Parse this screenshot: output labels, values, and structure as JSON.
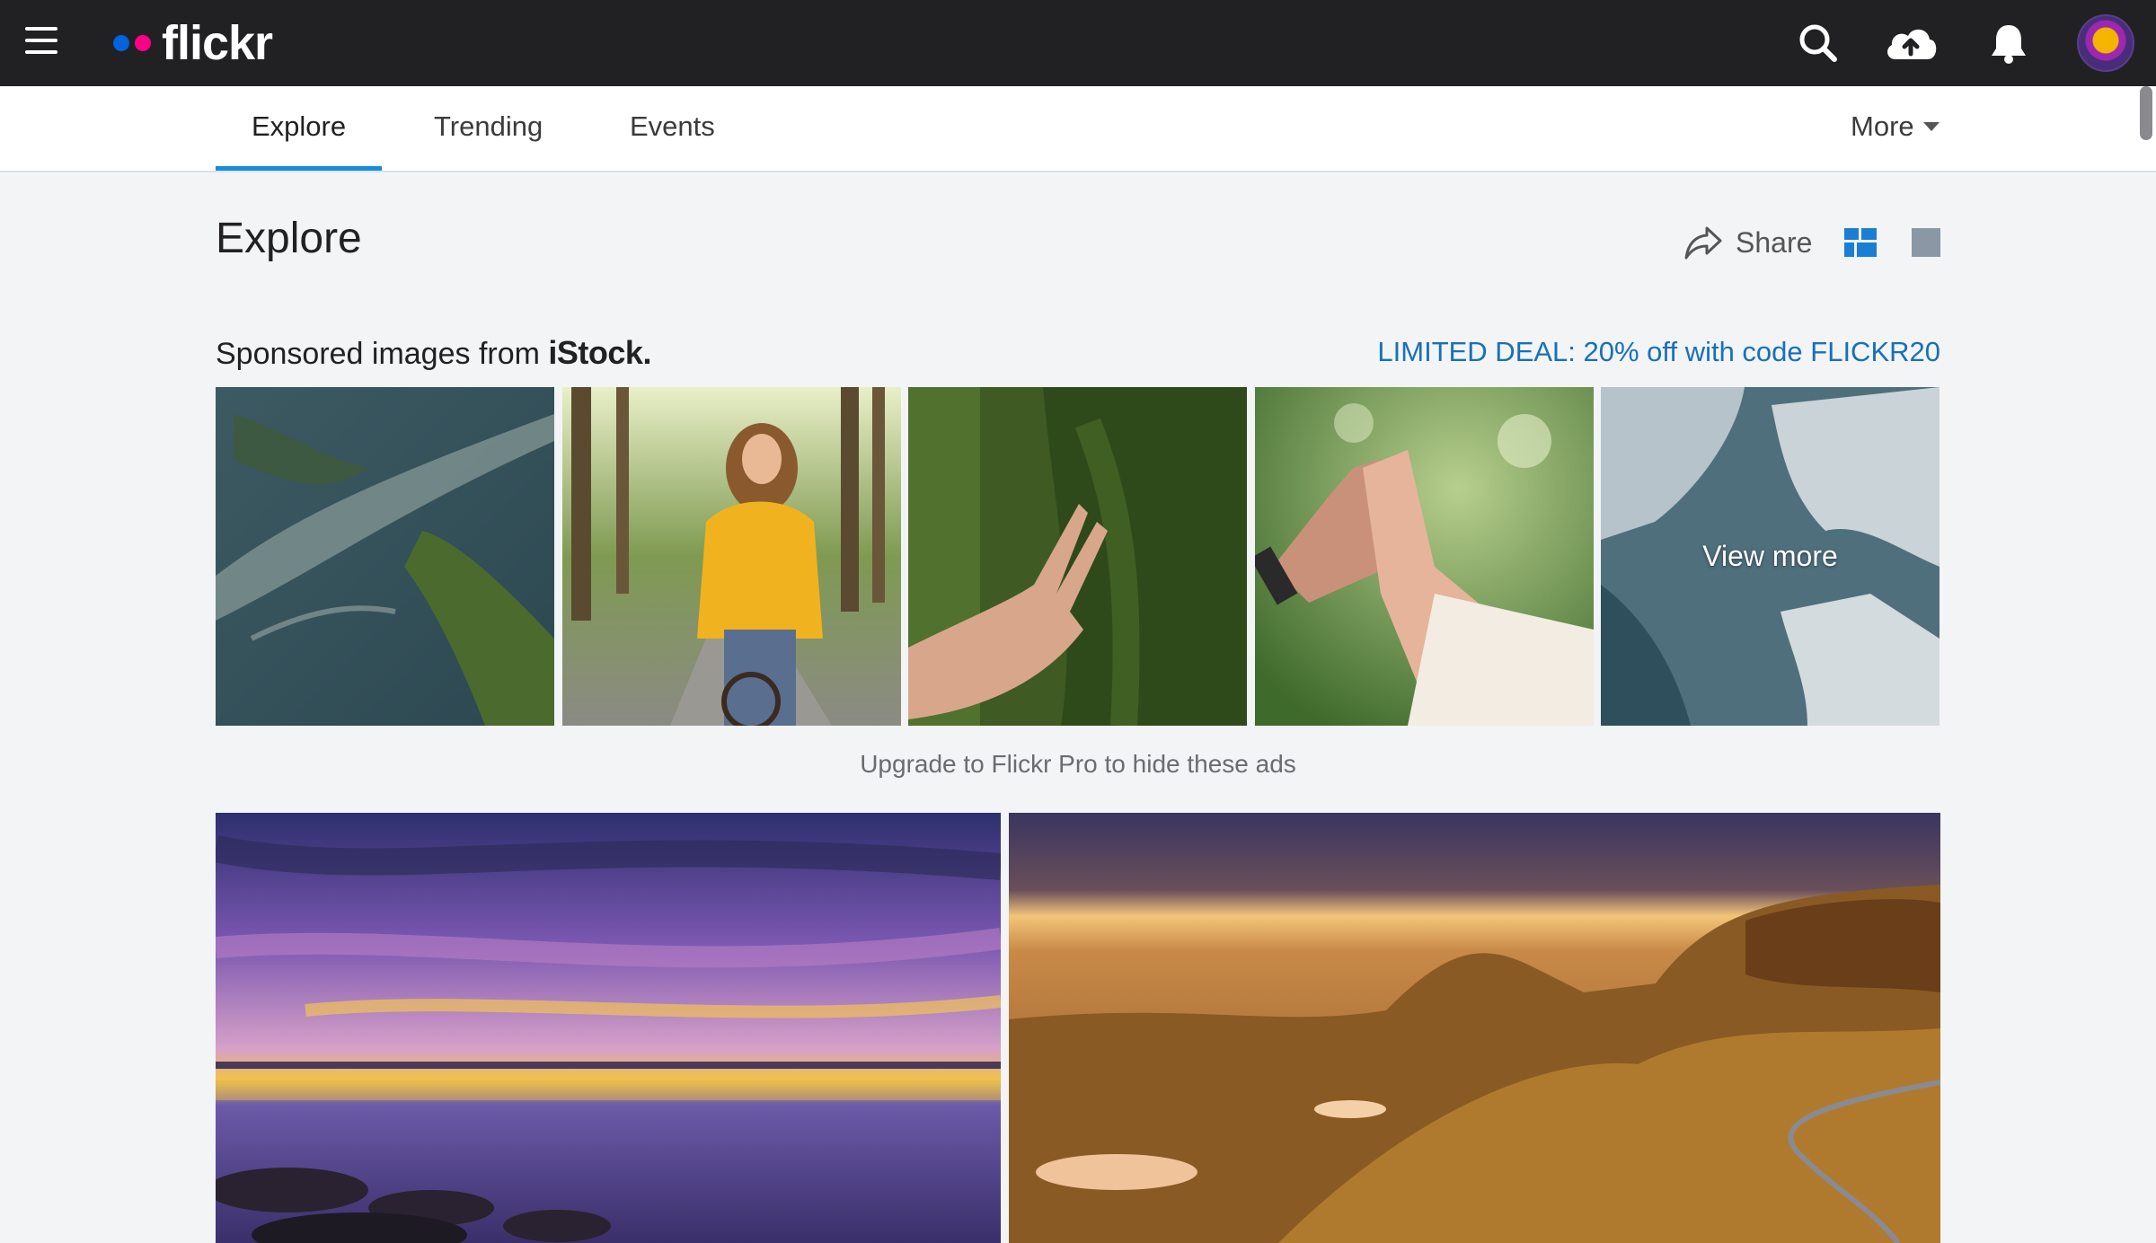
{
  "app": {
    "logo_text": "flickr",
    "logo_colors": {
      "blue": "#0063dc",
      "pink": "#ff0084"
    }
  },
  "topbar": {
    "icons": [
      "menu-icon",
      "search-icon",
      "upload-cloud-icon",
      "bell-icon",
      "avatar"
    ]
  },
  "subnav": {
    "tabs": [
      {
        "label": "Explore",
        "active": true
      },
      {
        "label": "Trending",
        "active": false
      },
      {
        "label": "Events",
        "active": false
      }
    ],
    "more_label": "More"
  },
  "header": {
    "title": "Explore",
    "share_label": "Share",
    "view_modes": [
      "grid-view-icon",
      "single-view-icon"
    ]
  },
  "sponsored": {
    "prefix": "Sponsored images from ",
    "brand": "iStock.",
    "deal": "LIMITED DEAL: 20% off with code FLICKR20",
    "images": [
      "aerial river landscape",
      "woman riding bicycle in yellow coat",
      "hand on mossy tree",
      "clasped hands high five",
      "aerial icy coastline"
    ],
    "view_more": "View more",
    "upgrade": "Upgrade to Flickr Pro to hide these ads"
  },
  "photos": [
    "purple sunset over lake",
    "golden mountain landscape"
  ],
  "accent_color": "#128fdc",
  "link_color": "#1870b8"
}
